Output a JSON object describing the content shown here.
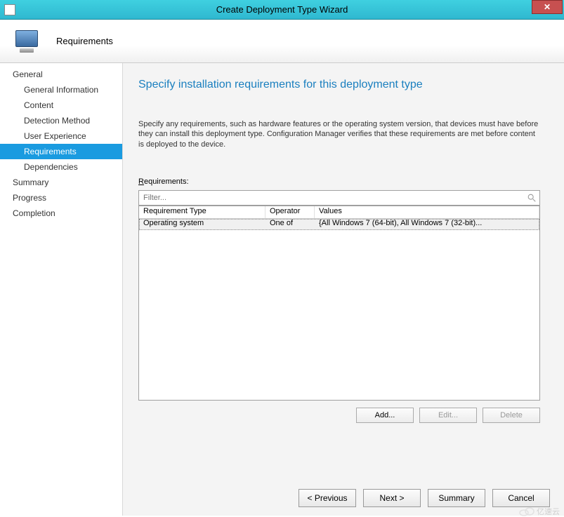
{
  "window": {
    "title": "Create Deployment Type Wizard",
    "close_symbol": "✕"
  },
  "banner": {
    "title": "Requirements"
  },
  "nav": {
    "general": "General",
    "items": [
      "General Information",
      "Content",
      "Detection Method",
      "User Experience",
      "Requirements",
      "Dependencies"
    ],
    "summary": "Summary",
    "progress": "Progress",
    "completion": "Completion",
    "active_index": 4
  },
  "page": {
    "heading": "Specify installation requirements for this deployment type",
    "description": "Specify any requirements, such as hardware features or the operating system version, that devices must have before they can install this deployment type. Configuration Manager verifies that these requirements are met before content is deployed to the device.",
    "requirements_label_prefix": "R",
    "requirements_label_rest": "equirements:",
    "filter_placeholder": "Filter..."
  },
  "grid": {
    "headers": {
      "type": "Requirement Type",
      "operator": "Operator",
      "values": "Values"
    },
    "rows": [
      {
        "type": "Operating system",
        "operator": "One of",
        "values": "{All Windows 7 (64-bit), All Windows 7 (32-bit)..."
      }
    ]
  },
  "buttons": {
    "add": "Add...",
    "edit": "Edit...",
    "delete": "Delete"
  },
  "footer": {
    "previous": "< Previous",
    "next": "Next >",
    "summary": "Summary",
    "cancel": "Cancel"
  },
  "watermark": "亿速云"
}
